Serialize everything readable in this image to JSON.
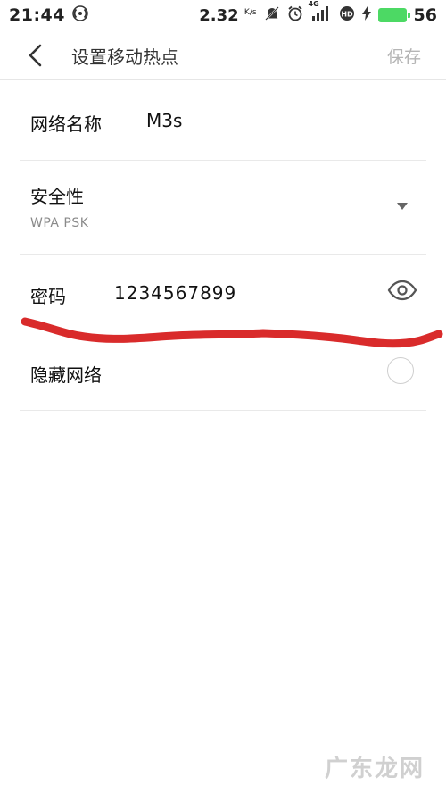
{
  "status_bar": {
    "time": "21:44",
    "network_speed": "2.32",
    "speed_unit": "K/s",
    "signal_tag": "4G",
    "battery_level": "56",
    "battery_color": "#4cd964"
  },
  "header": {
    "title": "设置移动热点",
    "back_icon": "chevron-left-icon",
    "save_label": "保存"
  },
  "form": {
    "ssid": {
      "label": "网络名称",
      "value": "M3s"
    },
    "security": {
      "label": "安全性",
      "value": "WPA PSK"
    },
    "password": {
      "label": "密码",
      "value": "1234567899"
    },
    "hidden_network": {
      "label": "隐藏网络",
      "checked": false
    }
  },
  "watermark": {
    "text": "广东龙网"
  },
  "annotation": {
    "color": "#d92b2b"
  }
}
